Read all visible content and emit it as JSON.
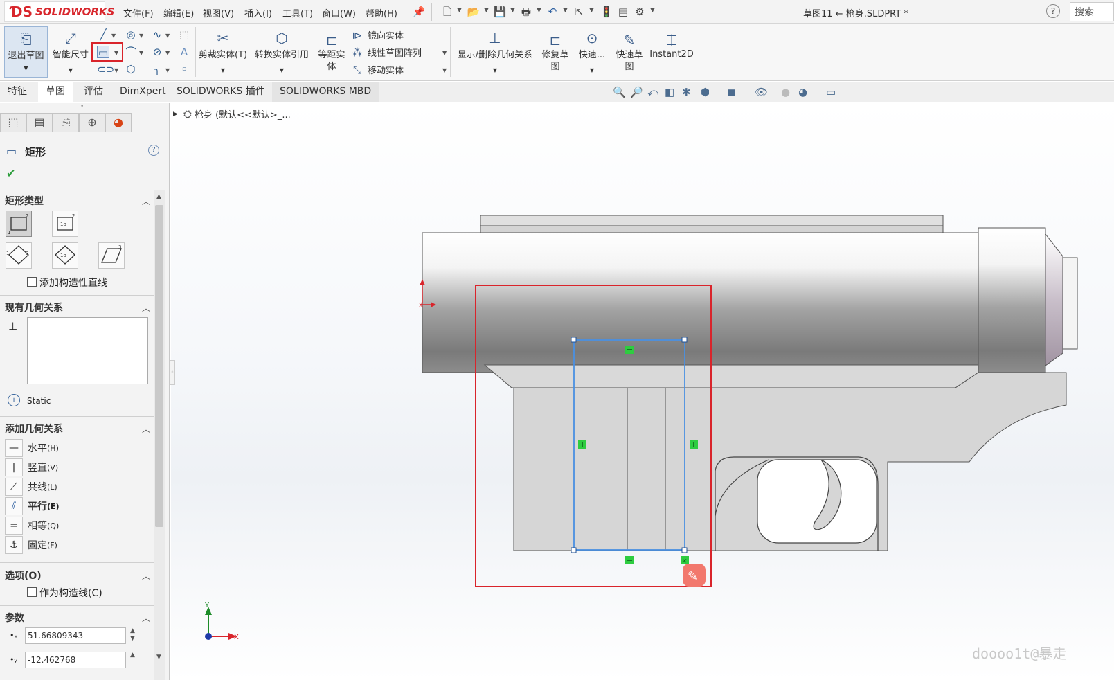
{
  "app": {
    "brand": "SOLIDWORKS",
    "doc_title": "草图11 ← 枪身.SLDPRT *",
    "search_label": "搜索"
  },
  "menu": [
    "文件(F)",
    "编辑(E)",
    "视图(V)",
    "插入(I)",
    "工具(T)",
    "窗口(W)",
    "帮助(H)"
  ],
  "ribbon": {
    "exit_sketch": "退出草图",
    "smart_dim": "智能尺寸",
    "trim": "剪裁实体(T)",
    "convert": "转换实体引用",
    "offset_1": "等距实",
    "offset_2": "体",
    "mirror": "镜向实体",
    "linear_pattern": "线性草图阵列",
    "move": "移动实体",
    "relations": "显示/删除几何关系",
    "repair_1": "修复草",
    "repair_2": "图",
    "quick_snap": "快速...",
    "rapid_1": "快速草",
    "rapid_2": "图",
    "instant2d": "Instant2D"
  },
  "tabs": [
    "特征",
    "草图",
    "评估",
    "DimXpert",
    "SOLIDWORKS 插件",
    "SOLIDWORKS MBD"
  ],
  "active_tab": "草图",
  "tree": {
    "part_label": "枪身 (默认<<默认>_..."
  },
  "property_manager": {
    "title": "矩形",
    "sections": {
      "rect_type": "矩形类型",
      "add_construction": "添加构造性直线",
      "existing_relations": "现有几何关系",
      "status": "Static",
      "add_relations": "添加几何关系",
      "options": "选项(O)",
      "as_construction": "作为构造线(C)",
      "parameters": "参数"
    },
    "relations": [
      {
        "label": "水平",
        "key": "(H)",
        "icon": "horizontal-icon"
      },
      {
        "label": "竖直",
        "key": "(V)",
        "icon": "vertical-icon"
      },
      {
        "label": "共线",
        "key": "(L)",
        "icon": "collinear-icon"
      },
      {
        "label": "平行",
        "key": "(E)",
        "icon": "parallel-icon"
      },
      {
        "label": "相等",
        "key": "(Q)",
        "icon": "equal-icon"
      },
      {
        "label": "固定",
        "key": "(F)",
        "icon": "fix-icon"
      }
    ],
    "params": {
      "x": "51.66809343",
      "y": "-12.462768"
    }
  },
  "axes": {
    "x": "X",
    "y": "Y"
  },
  "watermark": "doooo1t@暴走",
  "colors": {
    "selection_red": "#d9242b",
    "sketch_blue": "#4a90e2",
    "relation_green": "#2ecc40",
    "brand_red": "#d8262c"
  }
}
